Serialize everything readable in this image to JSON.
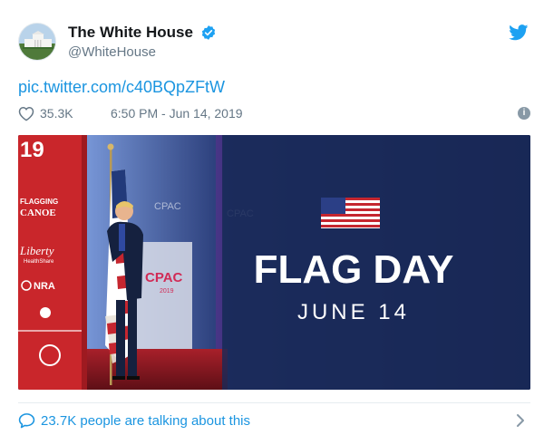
{
  "tweet": {
    "display_name": "The White House",
    "handle": "@WhiteHouse",
    "link_text": "pic.twitter.com/c40BQpZFtW",
    "likes": "35.3K",
    "timestamp": "6:50 PM - Jun 14, 2019",
    "info_label": "i",
    "footer_text": "23.7K people are talking about this"
  },
  "media": {
    "headline": "FLAG DAY",
    "date": "JUNE 14",
    "stage_year": "19",
    "sign_1": "FLAGGING",
    "sign_2": "CANOE",
    "sign_3": "Liberty",
    "sign_3_sub": "HealthShare",
    "sign_4": "NRA",
    "cpac": "CPAC",
    "cpac_year": "2019"
  },
  "colors": {
    "link": "#1b95e0",
    "muted": "#657786",
    "verified": "#1da1f2",
    "stage_red": "#c9262b",
    "banner_navy": "#1a2a58"
  },
  "icons": [
    "verified-badge-icon",
    "twitter-bird-icon",
    "heart-icon",
    "info-icon",
    "speech-bubble-icon",
    "chevron-right-icon"
  ]
}
